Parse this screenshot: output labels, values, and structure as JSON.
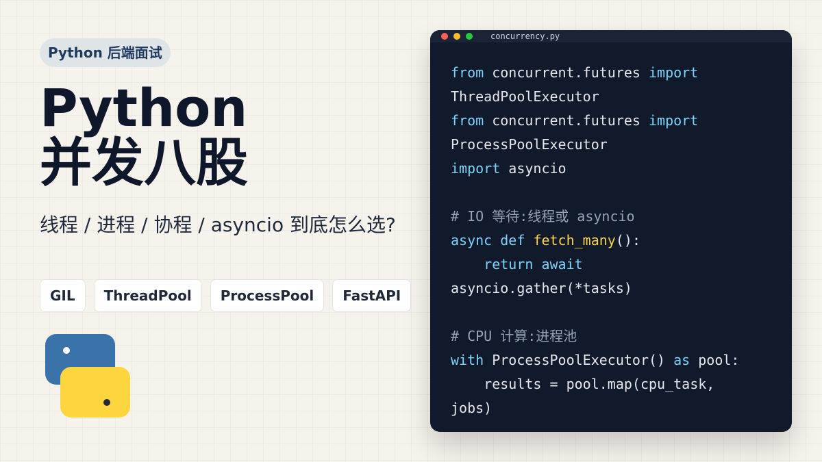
{
  "badge": "Python 后端面试",
  "title_line1": "Python",
  "title_line2": "并发八股",
  "subtitle": "线程 / 进程 / 协程 / asyncio 到底怎么选?",
  "tags": [
    "GIL",
    "ThreadPool",
    "ProcessPool",
    "FastAPI"
  ],
  "logo_icon": "python-logo-icon",
  "colors": {
    "accent_blue": "#3a73a9",
    "accent_yellow": "#fdd63f",
    "code_bg": "#111a2b",
    "keyword": "#7dd3fc",
    "function": "#fcd34d",
    "comment": "#94a3b8"
  },
  "editor": {
    "filename": "concurrency.py",
    "lines": [
      [
        {
          "t": "from",
          "c": "kw"
        },
        {
          "t": " concurrent.futures ",
          "c": ""
        },
        {
          "t": "import",
          "c": "kw"
        }
      ],
      [
        {
          "t": "ThreadPoolExecutor",
          "c": ""
        }
      ],
      [
        {
          "t": "from",
          "c": "kw"
        },
        {
          "t": " concurrent.futures ",
          "c": ""
        },
        {
          "t": "import",
          "c": "kw"
        }
      ],
      [
        {
          "t": "ProcessPoolExecutor",
          "c": ""
        }
      ],
      [
        {
          "t": "import",
          "c": "kw"
        },
        {
          "t": " asyncio",
          "c": ""
        }
      ],
      [],
      [
        {
          "t": "# IO 等待:线程或 asyncio",
          "c": "cm"
        }
      ],
      [
        {
          "t": "async",
          "c": "kw"
        },
        {
          "t": " ",
          "c": ""
        },
        {
          "t": "def",
          "c": "kw"
        },
        {
          "t": " ",
          "c": ""
        },
        {
          "t": "fetch_many",
          "c": "fn"
        },
        {
          "t": "():",
          "c": ""
        }
      ],
      [
        {
          "t": "    ",
          "c": ""
        },
        {
          "t": "return",
          "c": "kw"
        },
        {
          "t": " ",
          "c": ""
        },
        {
          "t": "await",
          "c": "kw"
        }
      ],
      [
        {
          "t": "asyncio.gather(*tasks)",
          "c": ""
        }
      ],
      [],
      [
        {
          "t": "# CPU 计算:进程池",
          "c": "cm"
        }
      ],
      [
        {
          "t": "with",
          "c": "kw"
        },
        {
          "t": " ProcessPoolExecutor() ",
          "c": ""
        },
        {
          "t": "as",
          "c": "kw"
        },
        {
          "t": " pool:",
          "c": ""
        }
      ],
      [
        {
          "t": "    results = pool.map(cpu_task,",
          "c": ""
        }
      ],
      [
        {
          "t": "jobs)",
          "c": ""
        }
      ]
    ]
  }
}
